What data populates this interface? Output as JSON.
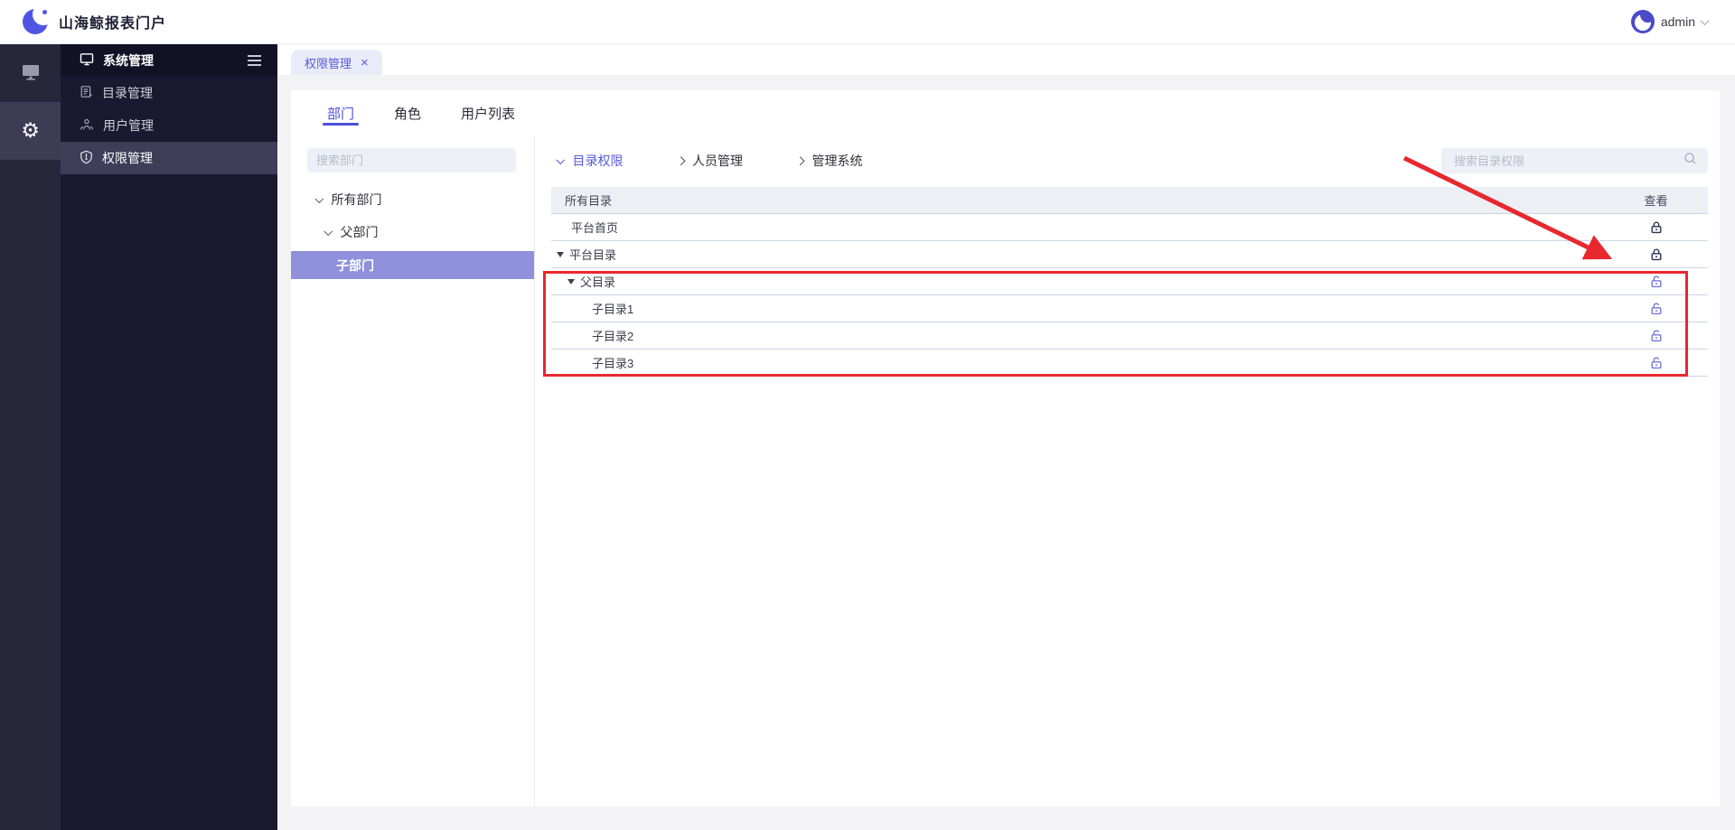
{
  "topbar": {
    "title": "山海鲸报表门户",
    "user_name": "admin"
  },
  "rail": {
    "items": [
      {
        "name": "screens",
        "icon": "monitor-icon",
        "active": false
      },
      {
        "name": "settings",
        "icon": "gear-icon",
        "active": true
      }
    ]
  },
  "sidebar": {
    "header": {
      "label": "系统管理",
      "icon": "screen-icon",
      "collapse_icon": "menu-collapse-icon"
    },
    "items": [
      {
        "label": "目录管理",
        "name": "directory-management",
        "icon": "document-icon",
        "active": false
      },
      {
        "label": "用户管理",
        "name": "user-management",
        "icon": "users-icon",
        "active": false
      },
      {
        "label": "权限管理",
        "name": "permission-management",
        "icon": "shield-icon",
        "active": true
      }
    ]
  },
  "tabstrip": {
    "tabs": [
      {
        "label": "权限管理",
        "closable": true,
        "active": true
      }
    ]
  },
  "content": {
    "tabs": [
      {
        "label": "部门",
        "name": "department",
        "active": true
      },
      {
        "label": "角色",
        "name": "role",
        "active": false
      },
      {
        "label": "用户列表",
        "name": "user-list",
        "active": false
      }
    ],
    "department_panel": {
      "search_placeholder": "搜索部门",
      "tree": [
        {
          "label": "所有部门",
          "level": 0,
          "expanded": true,
          "selected": false
        },
        {
          "label": "父部门",
          "level": 1,
          "expanded": true,
          "selected": false
        },
        {
          "label": "子部门",
          "level": 2,
          "expanded": false,
          "selected": true
        }
      ]
    },
    "permission_panel": {
      "sections": [
        {
          "label": "目录权限",
          "active": true
        },
        {
          "label": "人员管理",
          "active": false
        },
        {
          "label": "管理系统",
          "active": false
        }
      ],
      "search_placeholder": "搜索目录权限",
      "search_icon": "search-icon",
      "table": {
        "name_header": "所有目录",
        "view_header": "查看",
        "rows": [
          {
            "label": "平台首页",
            "indent": "child",
            "caret": false,
            "lock": "locked"
          },
          {
            "label": "平台目录",
            "indent": "root",
            "caret": true,
            "lock": "locked"
          },
          {
            "label": "父目录",
            "indent": "mid",
            "caret": true,
            "lock": "unlocked"
          },
          {
            "label": "子目录1",
            "indent": "leaf",
            "caret": false,
            "lock": "unlocked"
          },
          {
            "label": "子目录2",
            "indent": "leaf",
            "caret": false,
            "lock": "unlocked"
          },
          {
            "label": "子目录3",
            "indent": "leaf",
            "caret": false,
            "lock": "unlocked"
          }
        ]
      }
    }
  },
  "annotations": {
    "highlighted_rows": [
      "父目录",
      "子目录1",
      "子目录2",
      "子目录3"
    ],
    "color": "#e8272e"
  },
  "colors": {
    "accent": "#4c50d8",
    "sidebar_bg": "#1a1930",
    "tree_selected_bg": "#8f91dc",
    "locked_icon": "#2b3150",
    "unlocked_icon": "#7678d8"
  }
}
